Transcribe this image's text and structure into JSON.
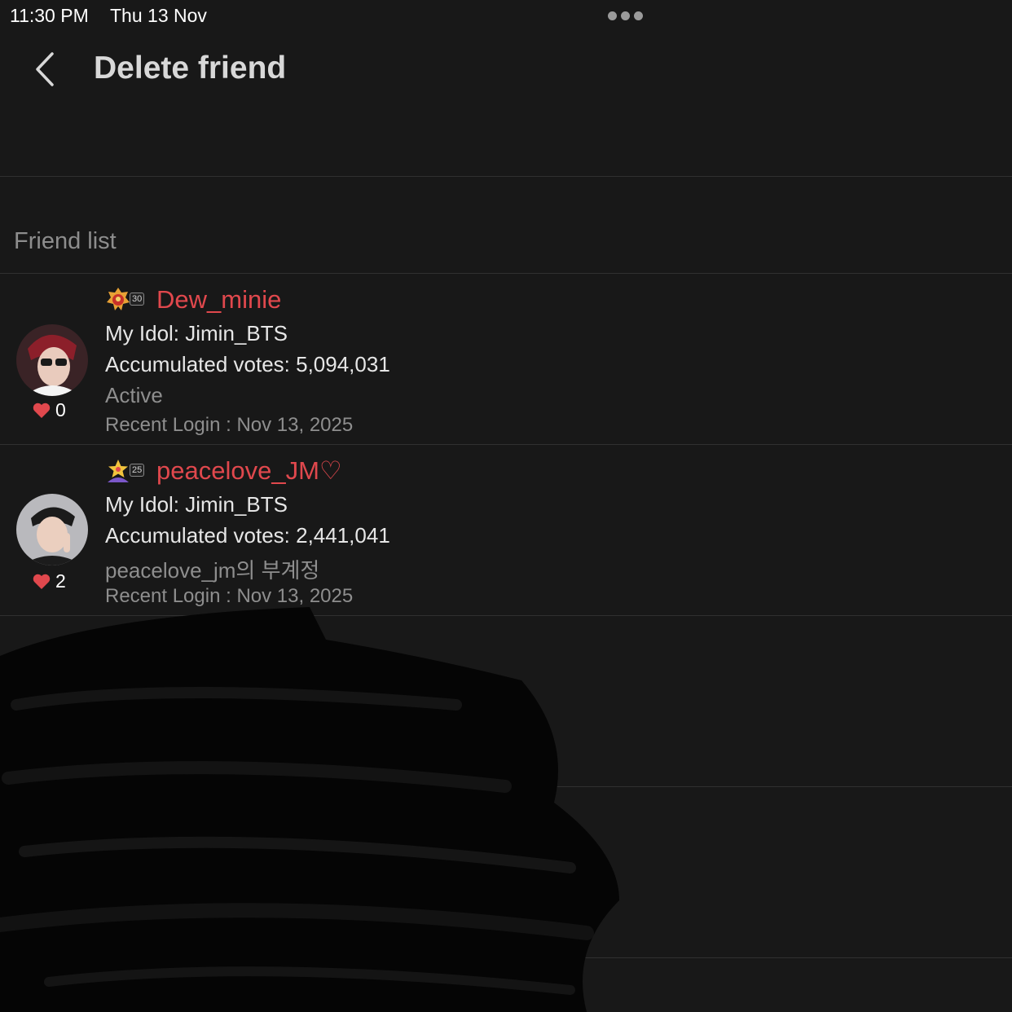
{
  "status_bar": {
    "time": "11:30 PM",
    "date": "Thu 13 Nov"
  },
  "header": {
    "title": "Delete friend"
  },
  "section_title": "Friend list",
  "friends": [
    {
      "name": "Dew_minie",
      "level": "30",
      "idol": "My Idol: Jimin_BTS",
      "votes": "Accumulated votes: 5,094,031",
      "status": "Active",
      "recent_login": "Recent Login : Nov 13, 2025",
      "likes": "0"
    },
    {
      "name": "peacelove_JM♡",
      "level": "25",
      "idol": "My Idol: Jimin_BTS",
      "votes": "Accumulated votes: 2,441,041",
      "status": "peacelove_jm의 부계정",
      "recent_login": "Recent Login : Nov 13, 2025",
      "likes": "2"
    }
  ],
  "colors": {
    "background": "#181818",
    "accent_name": "#e0484d",
    "heart": "#e0484d",
    "muted_text": "#8e8e8e"
  },
  "icons": [
    "back-chevron-icon",
    "more-dots-icon",
    "heart-icon",
    "rank-badge-icon"
  ]
}
